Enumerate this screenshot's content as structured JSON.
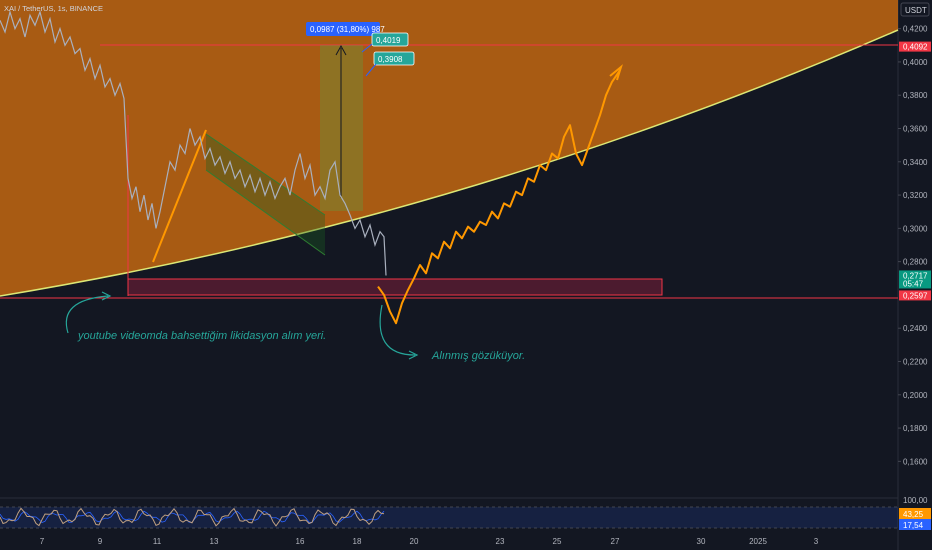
{
  "chart_data": {
    "type": "line",
    "header": {
      "symbol": "XAI / TetherUS, 1s, BINANCE"
    },
    "currency": "USDT",
    "price_axis": {
      "ylim": [
        0.15,
        0.433
      ],
      "ticks": [
        "0,4200",
        "0,4000",
        "0,3800",
        "0,3600",
        "0,3400",
        "0,3200",
        "0,3000",
        "0,2800",
        "0,2400",
        "0,2200",
        "0,2000",
        "0,1800",
        "0,1600"
      ]
    },
    "price_tags": [
      {
        "label": "0,4092",
        "value": 0.4092,
        "color": "#f23645"
      },
      {
        "label": "0,2717",
        "value": 0.2717,
        "color": "#089981",
        "sub": "05:47"
      },
      {
        "label": "0,2597",
        "value": 0.2597,
        "color": "#f23645"
      }
    ],
    "time_axis": {
      "labels": [
        "7",
        "9",
        "11",
        "13",
        "16",
        "18",
        "20",
        "23",
        "25",
        "27",
        "30",
        "2025",
        "3"
      ]
    },
    "price_series_x": [
      0,
      5,
      10,
      15,
      20,
      25,
      30,
      35,
      40,
      45,
      50,
      55,
      60,
      65,
      70,
      75,
      80,
      85,
      90,
      95,
      100,
      105,
      110,
      115,
      120,
      124,
      128,
      132,
      136,
      140,
      144,
      148,
      152,
      156,
      160,
      165,
      170,
      175,
      180,
      185,
      190,
      195,
      200,
      205,
      210,
      215,
      220,
      225,
      230,
      235,
      240,
      245,
      250,
      255,
      260,
      265,
      270,
      275,
      280,
      285,
      290,
      295,
      300,
      305,
      310,
      315,
      320,
      325,
      330,
      335,
      340,
      345,
      350,
      355,
      360,
      365,
      370,
      375,
      380,
      384,
      386
    ],
    "price_series_y": [
      0.425,
      0.418,
      0.43,
      0.42,
      0.426,
      0.415,
      0.428,
      0.422,
      0.43,
      0.418,
      0.426,
      0.412,
      0.42,
      0.41,
      0.415,
      0.405,
      0.408,
      0.395,
      0.402,
      0.39,
      0.398,
      0.385,
      0.39,
      0.38,
      0.387,
      0.378,
      0.33,
      0.318,
      0.325,
      0.31,
      0.32,
      0.305,
      0.315,
      0.3,
      0.31,
      0.325,
      0.34,
      0.335,
      0.35,
      0.345,
      0.36,
      0.35,
      0.355,
      0.342,
      0.348,
      0.338,
      0.343,
      0.333,
      0.34,
      0.33,
      0.335,
      0.325,
      0.332,
      0.322,
      0.33,
      0.32,
      0.328,
      0.318,
      0.325,
      0.33,
      0.32,
      0.335,
      0.345,
      0.33,
      0.338,
      0.32,
      0.325,
      0.318,
      0.335,
      0.34,
      0.32,
      0.315,
      0.308,
      0.3,
      0.305,
      0.295,
      0.302,
      0.29,
      0.298,
      0.295,
      0.2717
    ],
    "projection_x": [
      378,
      384,
      390,
      396,
      402,
      408,
      414,
      420,
      426,
      432,
      438,
      444,
      450,
      456,
      462,
      468,
      474,
      480,
      486,
      492,
      498,
      504,
      510,
      516,
      522,
      528,
      534,
      540,
      546,
      552,
      558,
      564,
      570,
      576,
      582,
      588,
      594,
      600,
      606,
      612,
      620
    ],
    "projection_y": [
      0.265,
      0.26,
      0.25,
      0.243,
      0.255,
      0.263,
      0.27,
      0.278,
      0.273,
      0.285,
      0.282,
      0.292,
      0.288,
      0.298,
      0.294,
      0.301,
      0.298,
      0.304,
      0.302,
      0.31,
      0.306,
      0.315,
      0.313,
      0.322,
      0.32,
      0.33,
      0.328,
      0.338,
      0.335,
      0.345,
      0.342,
      0.355,
      0.362,
      0.345,
      0.338,
      0.348,
      0.358,
      0.368,
      0.38,
      0.388,
      0.395
    ],
    "annotations": {
      "liquidity_note": "youtube videomda bahsettiğim likidasyon alım yeri.",
      "taken_note": "Alınmış gözüküyor.",
      "measure_label": "0,0987 (31,80%) 987",
      "tag_top": "0,4019",
      "tag_mid": "0,3908"
    },
    "rsi": {
      "ticks": [
        "100,00"
      ],
      "labels": [
        {
          "label": "43,25",
          "color": "#ff9800"
        },
        {
          "label": "17,54",
          "color": "#2962ff"
        }
      ]
    }
  }
}
